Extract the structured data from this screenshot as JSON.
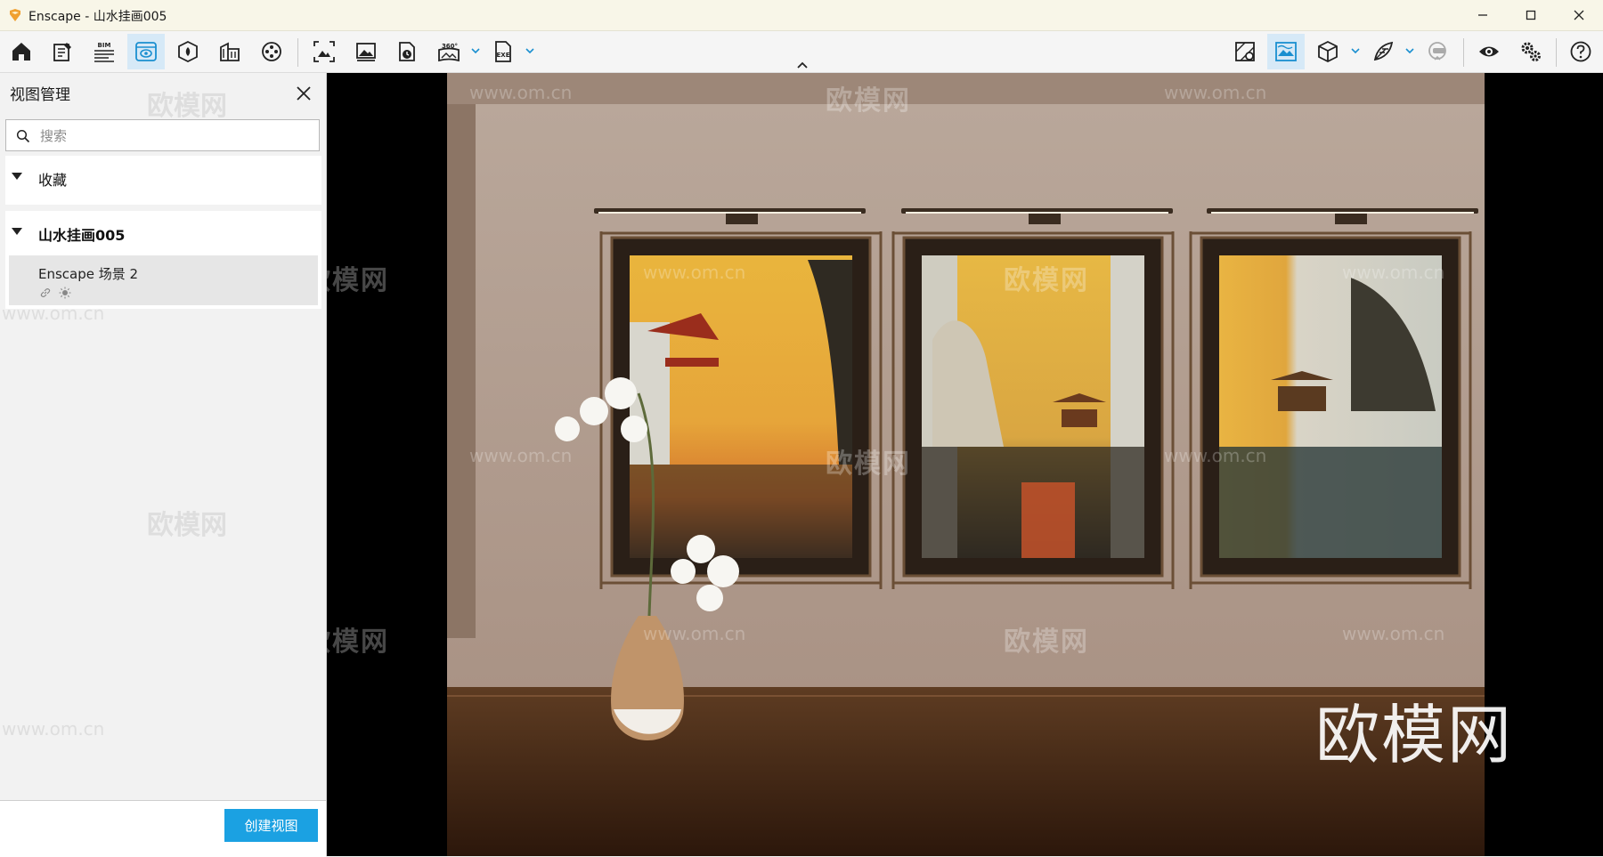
{
  "window": {
    "title": "Enscape - 山水挂画005",
    "controls": [
      "minimize",
      "maximize",
      "close"
    ]
  },
  "toolbar": {
    "left": [
      "home-icon",
      "notes-icon",
      "bim-icon",
      "views-icon",
      "material-icon",
      "assets-icon",
      "video-icon",
      "screenshot-icon",
      "image-icon",
      "batch-render-icon",
      "panorama-icon",
      "export-exe-icon"
    ],
    "right": [
      "site-context-icon",
      "atmosphere-icon",
      "cube-icon",
      "artistic-icon",
      "vr-headset-icon",
      "visibility-icon",
      "settings-icon",
      "help-icon"
    ],
    "bim_text": "BIM",
    "pano_text": "360°",
    "exe_text": "EXE",
    "active": "views-icon"
  },
  "panel": {
    "title": "视图管理",
    "search_placeholder": "搜索",
    "groups": [
      {
        "label": "收藏",
        "expanded": true,
        "items": []
      },
      {
        "label": "山水挂画005",
        "expanded": true,
        "items": [
          {
            "name": "Enscape 场景 2"
          }
        ]
      }
    ],
    "create_button": "创建视图"
  },
  "watermarks": {
    "brand": "欧模网",
    "url": "www.om.cn"
  },
  "colors": {
    "accent": "#1ba1e2",
    "active_tool_bg": "#d6e9f7",
    "titlebar_bg": "#f8f6e8"
  }
}
